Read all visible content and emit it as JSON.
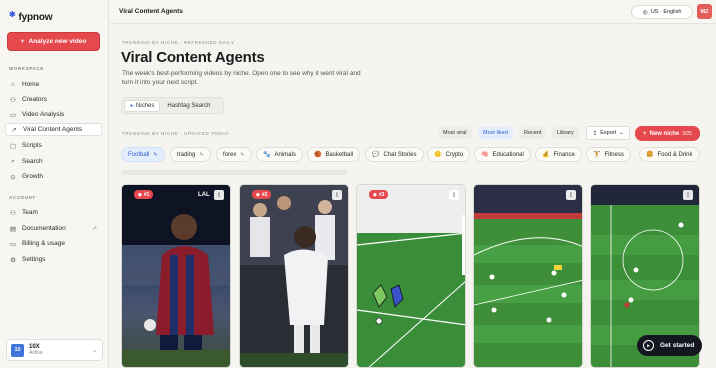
{
  "app": {
    "name": "fypnow"
  },
  "sidebar": {
    "analyze_button": "Analyze new video",
    "workspace_label": "WORKSPACE",
    "workspace_items": [
      {
        "label": "Home",
        "icon": "home-icon"
      },
      {
        "label": "Creators",
        "icon": "users-icon"
      },
      {
        "label": "Video Analysis",
        "icon": "document-icon"
      },
      {
        "label": "Viral Content Agents",
        "icon": "trending-icon",
        "active": true
      },
      {
        "label": "Scripts",
        "icon": "folder-icon"
      },
      {
        "label": "Search",
        "icon": "search-icon"
      },
      {
        "label": "Growth",
        "icon": "growth-icon"
      }
    ],
    "account_label": "ACCOUNT",
    "account_items": [
      {
        "label": "Team",
        "icon": "team-icon"
      },
      {
        "label": "Documentation",
        "icon": "book-icon"
      },
      {
        "label": "Billing & usage",
        "icon": "card-icon"
      },
      {
        "label": "Settings",
        "icon": "gear-icon"
      }
    ],
    "workspace_card": {
      "badge": "10",
      "name": "10X",
      "status": "Active"
    }
  },
  "topbar": {
    "title": "Viral Content Agents",
    "language": "US · English",
    "avatar_initials": "MZ"
  },
  "main": {
    "kicker": "TRENDING BY NICHE · REFRESHED DAILY",
    "title": "Viral Content Agents",
    "subtitle": "The week's best-performing videos by niche. Open one to see why it went viral and turn it into your next script.",
    "tabs": [
      {
        "label": "Niches",
        "active": true
      },
      {
        "label": "Hashtag Search",
        "active": false
      }
    ],
    "section_kicker": "TRENDING BY NICHE · UPDATED TODAY",
    "sort_options": [
      {
        "label": "Most viral",
        "active": false
      },
      {
        "label": "Most liked",
        "active": true
      },
      {
        "label": "Recent",
        "active": false
      },
      {
        "label": "Library",
        "active": false
      }
    ],
    "export_label": "Export",
    "new_niche": {
      "label": "New niche",
      "count": "3/25"
    },
    "chips": [
      {
        "label": "Football",
        "editable": true,
        "active": true
      },
      {
        "label": "trading",
        "editable": true
      },
      {
        "label": "forex",
        "editable": true
      },
      {
        "label": "Animals",
        "icon": "🐾"
      },
      {
        "label": "Basketball",
        "icon": "🏀"
      },
      {
        "label": "Chat Stories",
        "icon": "💬"
      },
      {
        "label": "Crypto",
        "icon": "🪙"
      },
      {
        "label": "Educational",
        "icon": "🧠"
      },
      {
        "label": "Finance",
        "icon": "💰"
      },
      {
        "label": "Fitness",
        "icon": "🏋"
      },
      {
        "label": "Food & Drink",
        "icon": "🍔"
      }
    ],
    "cards": [
      {
        "rank": "#1",
        "overlay": "LAL"
      },
      {
        "rank": "#2",
        "overlay": ""
      },
      {
        "rank": "#3",
        "overlay": ""
      },
      {
        "rank": "",
        "overlay": ""
      },
      {
        "rank": "",
        "overlay": ""
      }
    ],
    "get_started": "Get started"
  },
  "colors": {
    "accent": "#e5484d",
    "link": "#2c5fd1",
    "pitch": "#3f8f3a"
  }
}
